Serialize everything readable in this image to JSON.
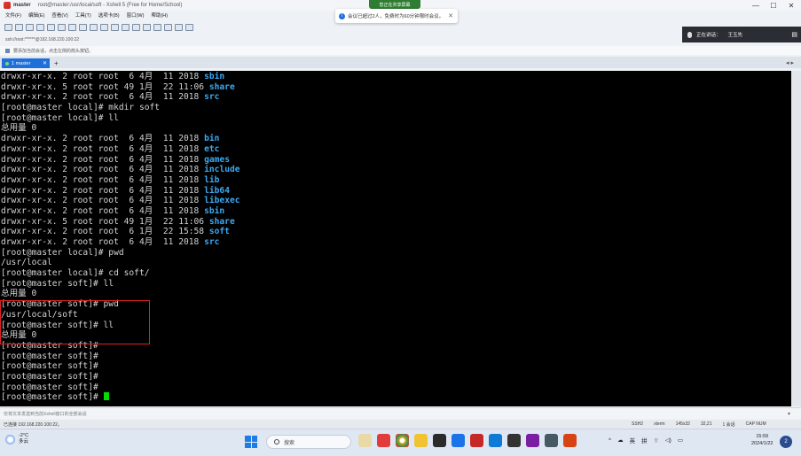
{
  "window": {
    "host": "master",
    "title": "root@master:/usr/local/soft - Xshell 5 (Free for Home/School)",
    "controls": [
      "—",
      "☐",
      "✕"
    ]
  },
  "menu": [
    "文件(F)",
    "编辑(E)",
    "查看(V)",
    "工具(T)",
    "选项卡(B)",
    "窗口(W)",
    "帮助(H)"
  ],
  "share_badge": "您正在共享屏幕",
  "notice": {
    "text": "会议已超过2人，免费时为60分钟限时会议。",
    "close": "✕"
  },
  "speaker": {
    "label": "正在讲话：",
    "name": "王玉先"
  },
  "address": "ssh://root:******@192.168.220.100:22",
  "hint": "要添加当前会话，点击左侧的箭头按钮。",
  "tab": {
    "label": "1 master",
    "close": "✕",
    "add": "+"
  },
  "tabnav": "◂ ▸",
  "terminal": {
    "lines": [
      {
        "pre": "drwxr-xr-x. 2 root root  6 4月  11 2018 ",
        "dir": "sbin"
      },
      {
        "pre": "drwxr-xr-x. 5 root root 49 1月  22 11:06 ",
        "dir": "share"
      },
      {
        "pre": "drwxr-xr-x. 2 root root  6 4月  11 2018 ",
        "dir": "src"
      },
      {
        "pre": "[root@master local]# mkdir soft",
        "dir": ""
      },
      {
        "pre": "[root@master local]# ll",
        "dir": ""
      },
      {
        "pre": "总用量 0",
        "dir": ""
      },
      {
        "pre": "drwxr-xr-x. 2 root root  6 4月  11 2018 ",
        "dir": "bin"
      },
      {
        "pre": "drwxr-xr-x. 2 root root  6 4月  11 2018 ",
        "dir": "etc"
      },
      {
        "pre": "drwxr-xr-x. 2 root root  6 4月  11 2018 ",
        "dir": "games"
      },
      {
        "pre": "drwxr-xr-x. 2 root root  6 4月  11 2018 ",
        "dir": "include"
      },
      {
        "pre": "drwxr-xr-x. 2 root root  6 4月  11 2018 ",
        "dir": "lib"
      },
      {
        "pre": "drwxr-xr-x. 2 root root  6 4月  11 2018 ",
        "dir": "lib64"
      },
      {
        "pre": "drwxr-xr-x. 2 root root  6 4月  11 2018 ",
        "dir": "libexec"
      },
      {
        "pre": "drwxr-xr-x. 2 root root  6 4月  11 2018 ",
        "dir": "sbin"
      },
      {
        "pre": "drwxr-xr-x. 5 root root 49 1月  22 11:06 ",
        "dir": "share"
      },
      {
        "pre": "drwxr-xr-x. 2 root root  6 1月  22 15:58 ",
        "dir": "soft"
      },
      {
        "pre": "drwxr-xr-x. 2 root root  6 4月  11 2018 ",
        "dir": "src"
      },
      {
        "pre": "[root@master local]# pwd",
        "dir": ""
      },
      {
        "pre": "/usr/local",
        "dir": ""
      },
      {
        "pre": "[root@master local]# cd soft/",
        "dir": ""
      },
      {
        "pre": "[root@master soft]# ll",
        "dir": ""
      },
      {
        "pre": "总用量 0",
        "dir": ""
      },
      {
        "pre": "[root@master soft]# pwd",
        "dir": ""
      },
      {
        "pre": "/usr/local/soft",
        "dir": ""
      },
      {
        "pre": "[root@master soft]# ll",
        "dir": ""
      },
      {
        "pre": "总用量 0",
        "dir": ""
      },
      {
        "pre": "[root@master soft]#",
        "dir": ""
      },
      {
        "pre": "[root@master soft]#",
        "dir": ""
      },
      {
        "pre": "[root@master soft]#",
        "dir": ""
      },
      {
        "pre": "[root@master soft]#",
        "dir": ""
      },
      {
        "pre": "[root@master soft]#",
        "dir": ""
      },
      {
        "pre": "[root@master soft]# ",
        "dir": ""
      }
    ],
    "dir_color": "#3ca9f2",
    "cursor_color": "#00e000"
  },
  "input_hint": "仅将文本发送到当前Xshell窗口的全部会话",
  "status": {
    "left": "已连接 192.168.220.100:22。",
    "items": [
      "SSH2",
      "xterm",
      "145x32",
      "32,21",
      "1 会话",
      "CAP NUM"
    ]
  },
  "taskbar": {
    "weather_temp": "-2°C",
    "weather_desc": "多云",
    "search": "搜索",
    "tray_lang": "英",
    "tray_ime": "拼",
    "time": "15:59",
    "date": "2024/1/22",
    "notif_count": "2"
  }
}
